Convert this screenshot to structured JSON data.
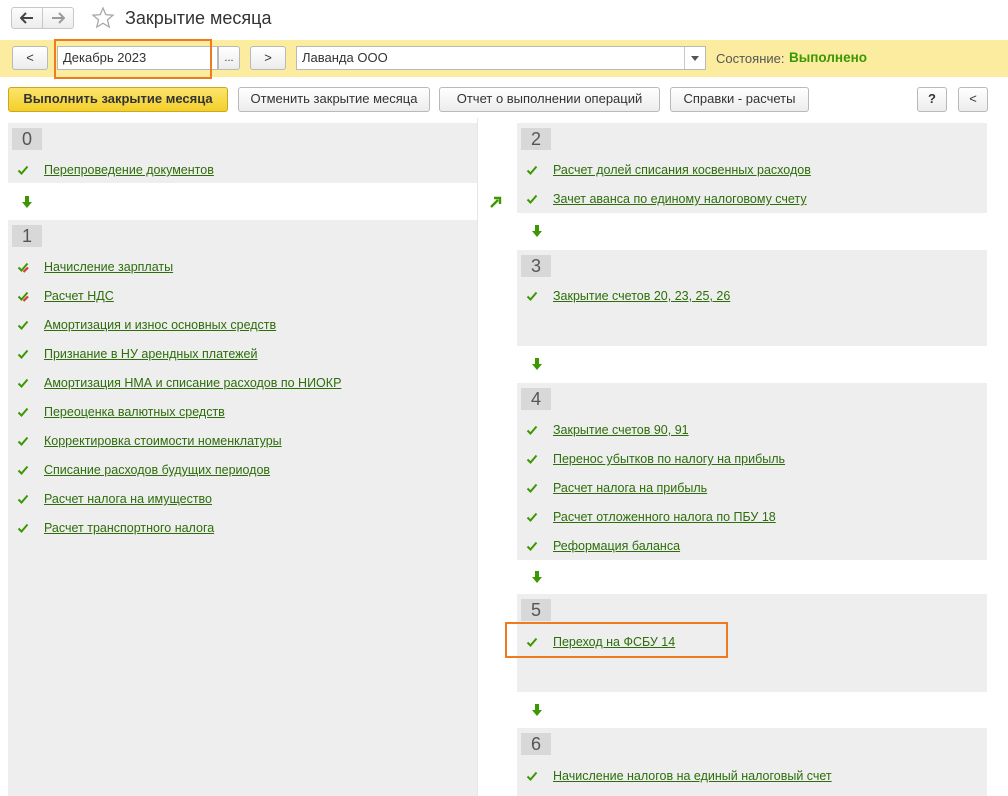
{
  "window": {
    "title": "Закрытие месяца",
    "back_icon": "arrow-left-icon",
    "forward_icon": "arrow-right-icon",
    "favorite_icon": "star-icon"
  },
  "filter": {
    "prev_label": "<",
    "period_value": "Декабрь 2023",
    "period_select_label": "...",
    "next_label": ">",
    "organization_value": "Лаванда ООО",
    "status_label": "Состояние:",
    "status_value": "Выполнено"
  },
  "toolbar": {
    "run_label": "Выполнить закрытие месяца",
    "cancel_label": "Отменить закрытие месяца",
    "report_label": "Отчет о выполнении операций",
    "reference_label": "Справки - расчеты",
    "help_label": "?",
    "collapse_label": "<"
  },
  "colors": {
    "accent_green": "#3c9800",
    "link_green": "#2d6e0a",
    "filter_bg": "#fbeca0",
    "primary_button": "#f4cf2a",
    "highlight": "#f07a1e"
  },
  "stages": [
    {
      "number": "0",
      "operations": [
        {
          "label": "Перепроведение документов",
          "status": "done"
        }
      ]
    },
    {
      "number": "1",
      "operations": [
        {
          "label": "Начисление зарплаты",
          "status": "done-warning"
        },
        {
          "label": "Расчет НДС",
          "status": "done-warning"
        },
        {
          "label": "Амортизация и износ основных средств",
          "status": "done"
        },
        {
          "label": "Признание в НУ арендных платежей",
          "status": "done"
        },
        {
          "label": "Амортизация НМА и списание расходов по НИОКР",
          "status": "done"
        },
        {
          "label": "Переоценка валютных средств",
          "status": "done"
        },
        {
          "label": "Корректировка стоимости номенклатуры",
          "status": "done"
        },
        {
          "label": "Списание расходов будущих периодов",
          "status": "done"
        },
        {
          "label": "Расчет налога на имущество",
          "status": "done"
        },
        {
          "label": "Расчет транспортного налога",
          "status": "done"
        }
      ]
    },
    {
      "number": "2",
      "operations": [
        {
          "label": "Расчет долей списания косвенных расходов",
          "status": "done"
        },
        {
          "label": "Зачет аванса по единому налоговому счету",
          "status": "done"
        }
      ]
    },
    {
      "number": "3",
      "operations": [
        {
          "label": "Закрытие счетов 20, 23, 25, 26",
          "status": "done"
        }
      ]
    },
    {
      "number": "4",
      "operations": [
        {
          "label": "Закрытие счетов 90, 91",
          "status": "done"
        },
        {
          "label": "Перенос убытков по налогу на прибыль",
          "status": "done"
        },
        {
          "label": "Расчет налога на прибыль",
          "status": "done"
        },
        {
          "label": "Расчет отложенного налога по ПБУ 18",
          "status": "done"
        },
        {
          "label": "Реформация баланса",
          "status": "done"
        }
      ]
    },
    {
      "number": "5",
      "operations": [
        {
          "label": "Переход на ФСБУ 14",
          "status": "done"
        }
      ]
    },
    {
      "number": "6",
      "operations": [
        {
          "label": "Начисление налогов на единый налоговый счет",
          "status": "done"
        }
      ]
    }
  ]
}
